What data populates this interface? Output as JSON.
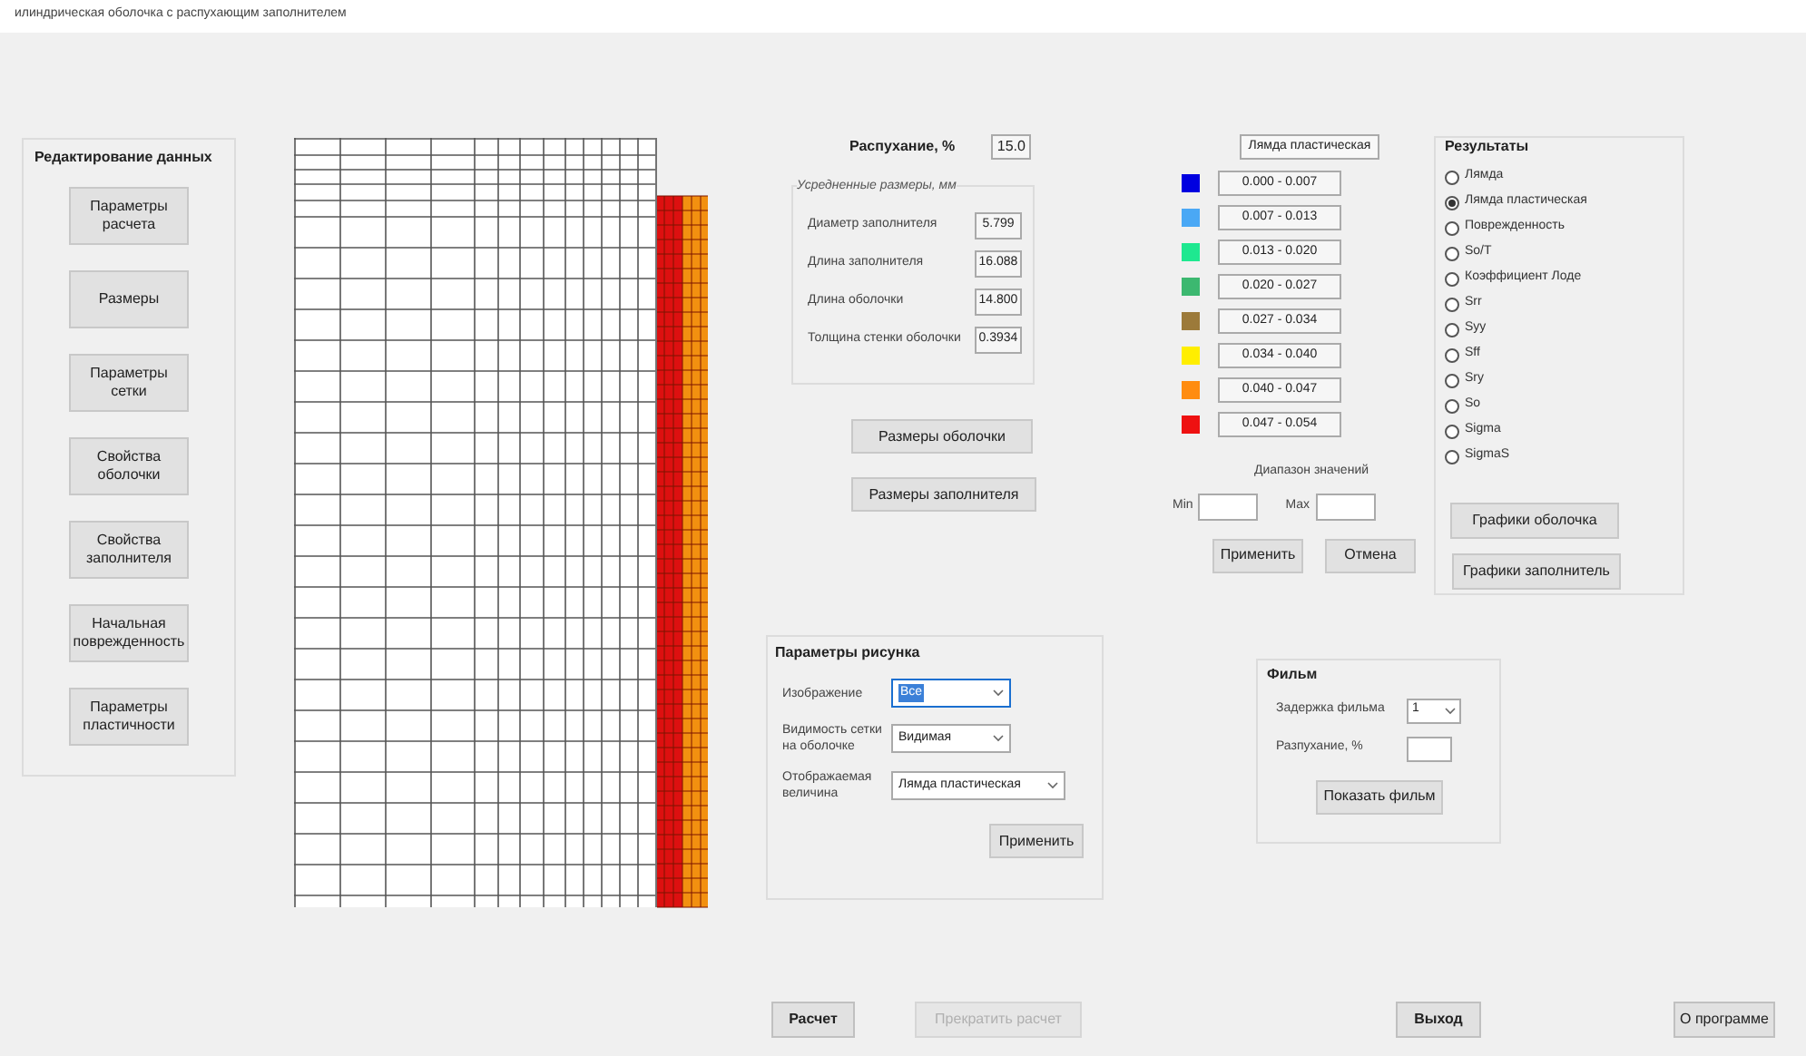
{
  "window": {
    "title": "илиндрическая оболочка с распухающим заполнителем"
  },
  "editing": {
    "title": "Редактирование данных",
    "buttons": [
      "Параметры расчета",
      "Размеры",
      "Параметры сетки",
      "Свойства оболочки",
      "Свойства заполнителя",
      "Начальная поврежденность",
      "Параметры пластичности"
    ]
  },
  "swelling": {
    "label": "Распухание, %",
    "value": "15.0"
  },
  "averaged": {
    "title": "Усредненные размеры, мм",
    "rows": [
      {
        "label": "Диаметр заполнителя",
        "value": "5.799"
      },
      {
        "label": "Длина заполнителя",
        "value": "16.088"
      },
      {
        "label": "Длина оболочки",
        "value": "14.800"
      },
      {
        "label": "Толщина стенки оболочки",
        "value": "0.3934"
      }
    ]
  },
  "size_buttons": [
    "Размеры оболочки",
    "Размеры заполнителя"
  ],
  "legend": {
    "header": "Лямда пластическая",
    "items": [
      {
        "color": "#0000e0",
        "range": "0.000 - 0.007"
      },
      {
        "color": "#4aa8f5",
        "range": "0.007 - 0.013"
      },
      {
        "color": "#1ee890",
        "range": "0.013 - 0.020"
      },
      {
        "color": "#3cb870",
        "range": "0.020 - 0.027"
      },
      {
        "color": "#9c7a3a",
        "range": "0.027 - 0.034"
      },
      {
        "color": "#ffee00",
        "range": "0.034 - 0.040"
      },
      {
        "color": "#ff8c10",
        "range": "0.040 - 0.047"
      },
      {
        "color": "#ee1111",
        "range": "0.047 - 0.054"
      }
    ]
  },
  "range": {
    "title": "Диапазон значений",
    "min_label": "Min",
    "max_label": "Max",
    "buttons": [
      "Применить",
      "Отмена"
    ]
  },
  "results": {
    "title": "Результаты",
    "options": [
      {
        "label": "Лямда",
        "selected": false
      },
      {
        "label": "Лямда пластическая",
        "selected": true
      },
      {
        "label": "Поврежденность",
        "selected": false
      },
      {
        "label": "So/T",
        "selected": false
      },
      {
        "label": "Коэффициент Лоде",
        "selected": false
      },
      {
        "label": "Srr",
        "selected": false
      },
      {
        "label": "Syy",
        "selected": false
      },
      {
        "label": "Sff",
        "selected": false
      },
      {
        "label": "Sry",
        "selected": false
      },
      {
        "label": "So",
        "selected": false
      },
      {
        "label": "Sigma",
        "selected": false
      },
      {
        "label": "SigmaS",
        "selected": false
      }
    ],
    "buttons": [
      "Графики оболочка",
      "Графики заполнитель"
    ]
  },
  "picture_params": {
    "title": "Параметры рисунка",
    "fields": [
      {
        "label": "Изображение",
        "value": "Все",
        "highlighted": true
      },
      {
        "label": "Видимость сетки на оболочке",
        "value": "Видимая",
        "highlighted": false
      },
      {
        "label": "Отображаемая величина",
        "value": "Лямда пластическая",
        "highlighted": false
      }
    ],
    "button": "Применить"
  },
  "film": {
    "title": "Фильм",
    "delay_label": "Задержка фильма",
    "delay_value": "1",
    "swelling_label": "Разпухание, %",
    "button": "Показать фильм"
  },
  "bottom_buttons": [
    {
      "label": "Расчет",
      "bold": true,
      "disabled": false
    },
    {
      "label": "Прекратить расчет",
      "bold": false,
      "disabled": true
    },
    {
      "label": "Выход",
      "bold": true,
      "disabled": false
    },
    {
      "label": "О программе",
      "bold": false,
      "disabled": false
    }
  ]
}
